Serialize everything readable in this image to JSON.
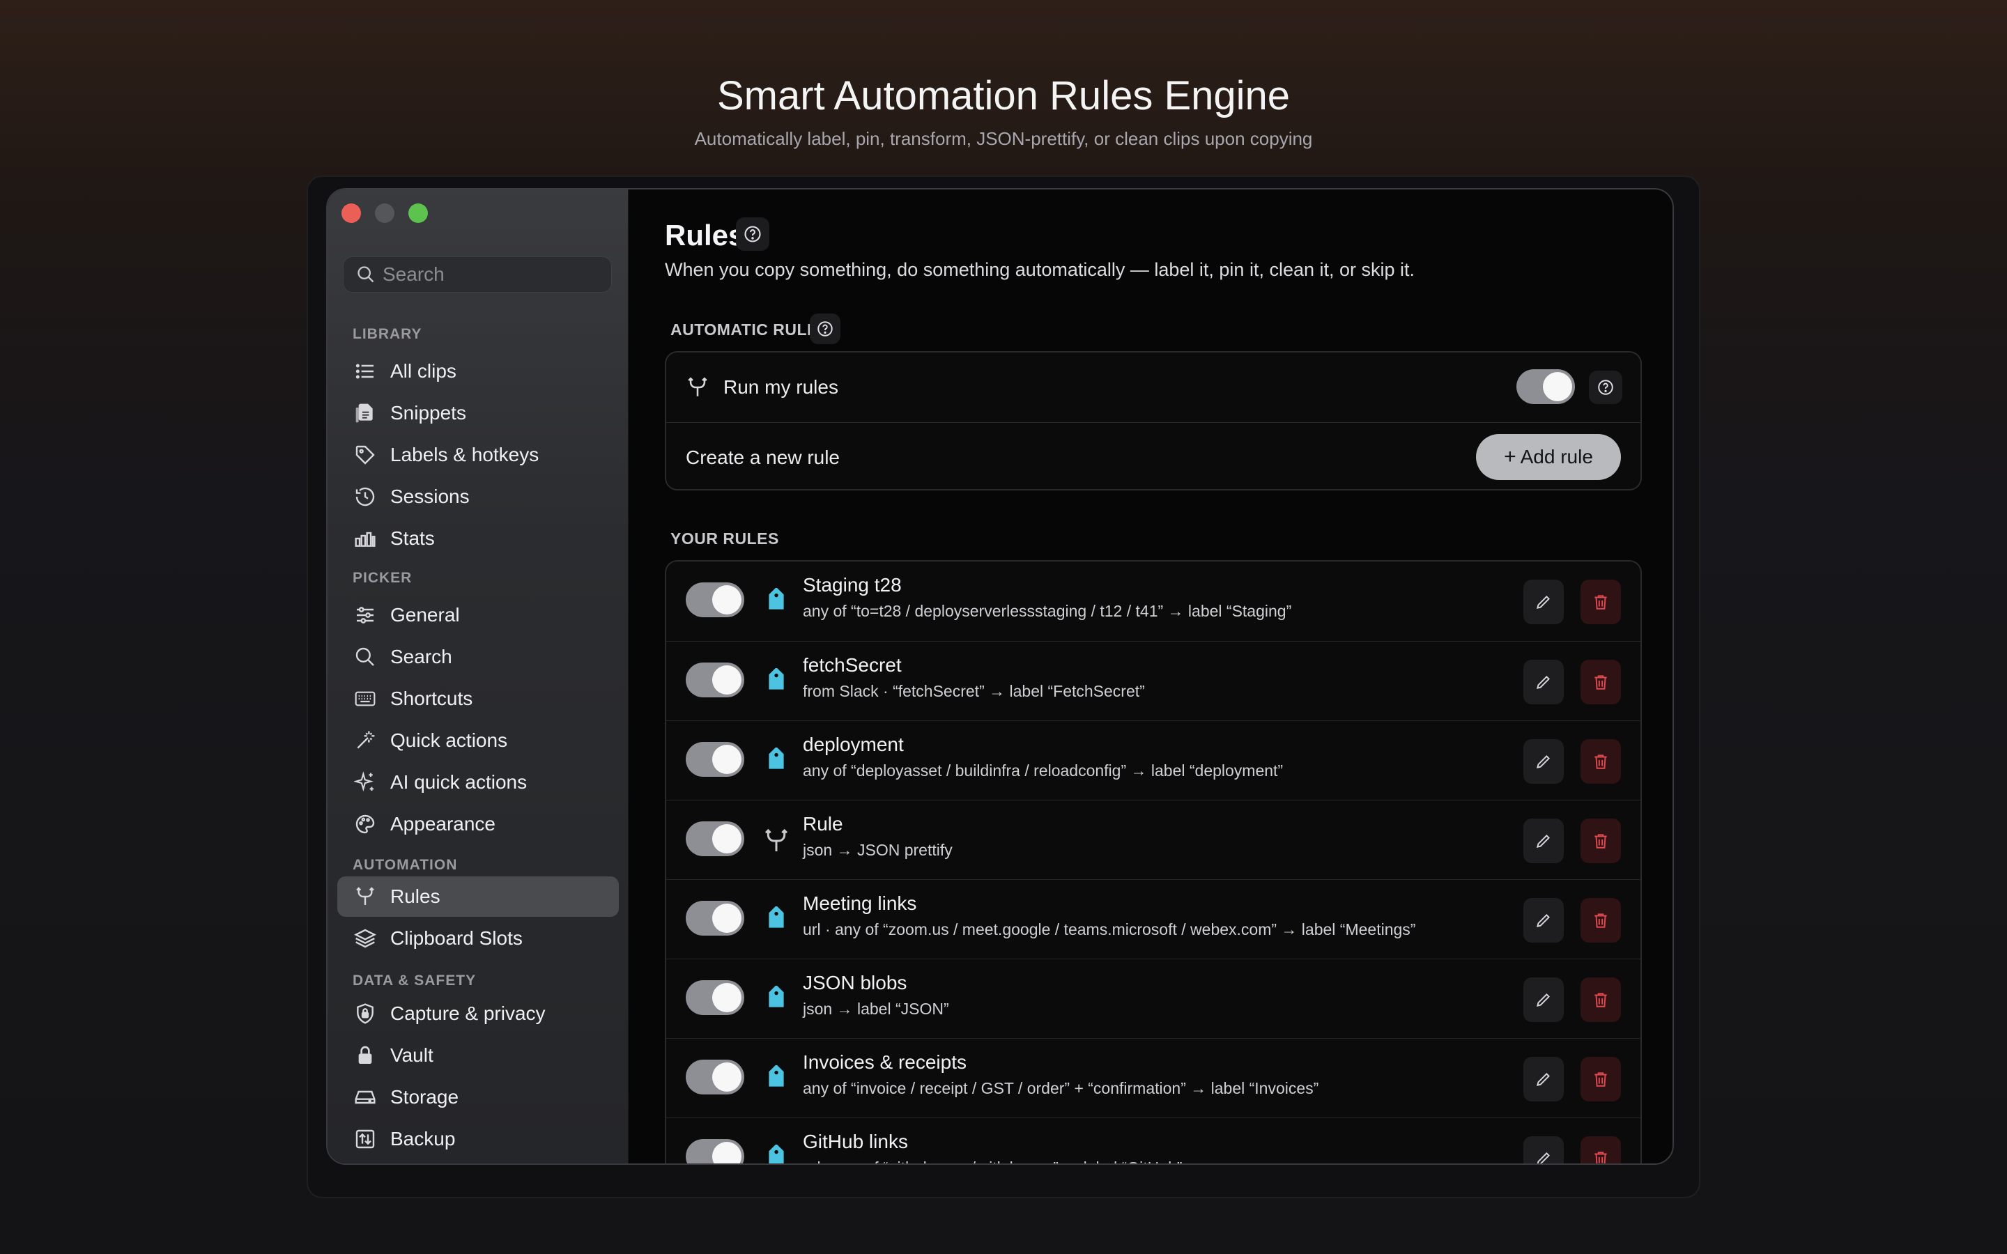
{
  "hero": {
    "title": "Smart Automation Rules Engine",
    "subtitle": "Automatically label, pin, transform, JSON-prettify, or clean clips upon copying"
  },
  "sidebar": {
    "search_placeholder": "Search",
    "sections": [
      {
        "label": "LIBRARY",
        "items": [
          {
            "label": "All clips",
            "icon": "list-icon"
          },
          {
            "label": "Snippets",
            "icon": "documents-icon"
          },
          {
            "label": "Labels & hotkeys",
            "icon": "tag-icon"
          },
          {
            "label": "Sessions",
            "icon": "history-icon"
          },
          {
            "label": "Stats",
            "icon": "bar-chart-icon"
          }
        ]
      },
      {
        "label": "PICKER",
        "items": [
          {
            "label": "General",
            "icon": "sliders-icon"
          },
          {
            "label": "Search",
            "icon": "search-icon"
          },
          {
            "label": "Shortcuts",
            "icon": "keyboard-icon"
          },
          {
            "label": "Quick actions",
            "icon": "magic-wand-icon"
          },
          {
            "label": "AI quick actions",
            "icon": "sparkles-icon"
          },
          {
            "label": "Appearance",
            "icon": "palette-icon"
          }
        ]
      },
      {
        "label": "AUTOMATION",
        "items": [
          {
            "label": "Rules",
            "icon": "branch-icon",
            "active": true
          },
          {
            "label": "Clipboard Slots",
            "icon": "layers-icon"
          }
        ]
      },
      {
        "label": "DATA & SAFETY",
        "items": [
          {
            "label": "Capture & privacy",
            "icon": "shield-lock-icon"
          },
          {
            "label": "Vault",
            "icon": "lock-icon"
          },
          {
            "label": "Storage",
            "icon": "drive-icon"
          },
          {
            "label": "Backup",
            "icon": "backup-icon"
          }
        ]
      }
    ]
  },
  "main": {
    "title": "Rules",
    "description": "When you copy something, do something automatically — label it, pin it, clean it, or skip it.",
    "automatic_rules": {
      "label": "AUTOMATIC RULES",
      "run_label": "Run my rules",
      "run_enabled": true,
      "create_label": "Create a new rule",
      "add_button": "Add rule"
    },
    "your_rules": {
      "label": "YOUR RULES",
      "rules": [
        {
          "name": "Staging t28",
          "desc": "any of “to=t28 / deployserverlessstaging / t12 / t41” → label “Staging”",
          "icon": "tag-icon",
          "enabled": true
        },
        {
          "name": "fetchSecret",
          "desc": "from Slack · “fetchSecret” → label “FetchSecret”",
          "icon": "tag-icon",
          "enabled": true
        },
        {
          "name": "deployment",
          "desc": "any of “deployasset / buildinfra / reloadconfig” → label “deployment”",
          "icon": "tag-icon",
          "enabled": true
        },
        {
          "name": "Rule",
          "desc": "json → JSON prettify",
          "icon": "branch-icon",
          "enabled": true
        },
        {
          "name": "Meeting links",
          "desc": "url · any of “zoom.us / meet.google / teams.microsoft / webex.com” → label “Meetings”",
          "icon": "tag-icon",
          "enabled": true
        },
        {
          "name": "JSON blobs",
          "desc": "json → label “JSON”",
          "icon": "tag-icon",
          "enabled": true
        },
        {
          "name": "Invoices & receipts",
          "desc": "any of “invoice / receipt / GST / order” + “confirmation” → label “Invoices”",
          "icon": "tag-icon",
          "enabled": true
        },
        {
          "name": "GitHub links",
          "desc": "url · any of “github.com / gitlab.com” → label “GitHub”",
          "icon": "tag-icon",
          "enabled": true
        }
      ]
    }
  },
  "colors": {
    "tag_accent": "#4cc3e0",
    "delete_accent": "#e0494f",
    "toggle_on": "#8e8f94"
  }
}
